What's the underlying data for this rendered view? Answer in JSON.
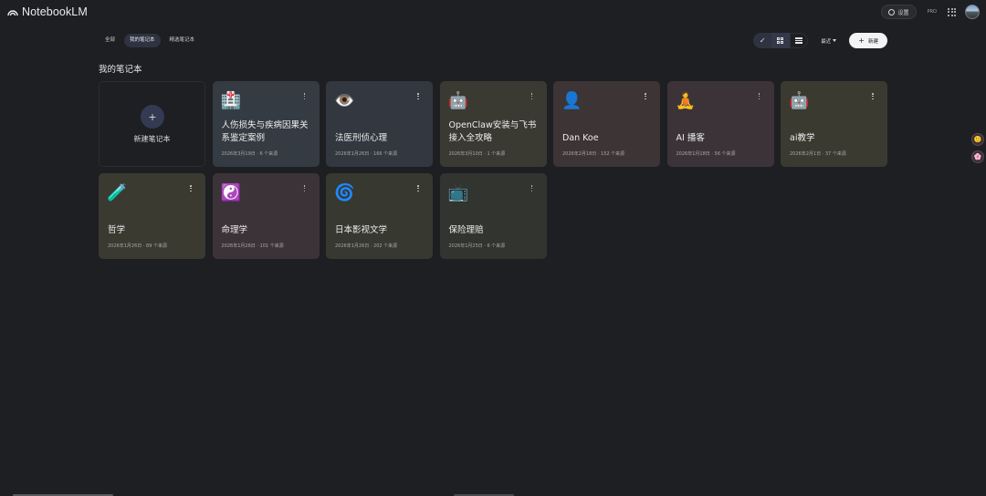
{
  "app": {
    "name": "NotebookLM"
  },
  "top_right": {
    "settings_label": "设置",
    "pro_label": "PRO"
  },
  "filters": [
    {
      "label": "全部",
      "active": false
    },
    {
      "label": "我的笔记本",
      "active": true
    },
    {
      "label": "精选笔记本",
      "active": false
    }
  ],
  "controls": {
    "sort_label": "最近",
    "new_label": "新建"
  },
  "section_title": "我的笔记本",
  "new_notebook_label": "新建笔记本",
  "colors": {
    "background": "#1e1f22",
    "chip_active": "#2f3341",
    "new_button": "#f1f3f4"
  },
  "notebooks": [
    {
      "emoji": "🏥",
      "icon": "hospital-icon",
      "title": "人伤损失与疾病因果关系鉴定案例",
      "meta": "2026年3月19日 · 6 个来源",
      "bg": "#353b42"
    },
    {
      "emoji": "👁️",
      "icon": "eye-icon",
      "title": "法医刑侦心理",
      "meta": "2026年1月26日 · 166 个来源",
      "bg": "#33373f"
    },
    {
      "emoji": "🤖",
      "icon": "robot-icon",
      "title": "OpenClaw安装与飞书接入全攻略",
      "meta": "2026年3月10日 · 1 个来源",
      "bg": "#3a3a33"
    },
    {
      "emoji": "👤",
      "icon": "person-icon",
      "title": "Dan Koe",
      "meta": "2026年2月18日 · 152 个来源",
      "bg": "#3d3535"
    },
    {
      "emoji": "🧘",
      "icon": "meditation-icon",
      "title": "AI 播客",
      "meta": "2026年1月18日 · 56 个来源",
      "bg": "#3c3338"
    },
    {
      "emoji": "🤖",
      "icon": "robot-icon",
      "title": "ai教学",
      "meta": "2026年2月1日 · 37 个来源",
      "bg": "#3a3a31"
    },
    {
      "emoji": "🧪",
      "icon": "tools-icon",
      "title": "哲学",
      "meta": "2026年1月26日 · 89 个来源",
      "bg": "#3a3a31"
    },
    {
      "emoji": "☯️",
      "icon": "yin-yang-icon",
      "title": "命理学",
      "meta": "2026年1月26日 · 101 个来源",
      "bg": "#3c3338"
    },
    {
      "emoji": "🌀",
      "icon": "globe-icon",
      "title": "日本影视文学",
      "meta": "2026年1月26日 · 202 个来源",
      "bg": "#37382f"
    },
    {
      "emoji": "📺",
      "icon": "tv-icon",
      "title": "保险理赔",
      "meta": "2026年1月25日 · 6 个来源",
      "bg": "#31342f"
    }
  ]
}
